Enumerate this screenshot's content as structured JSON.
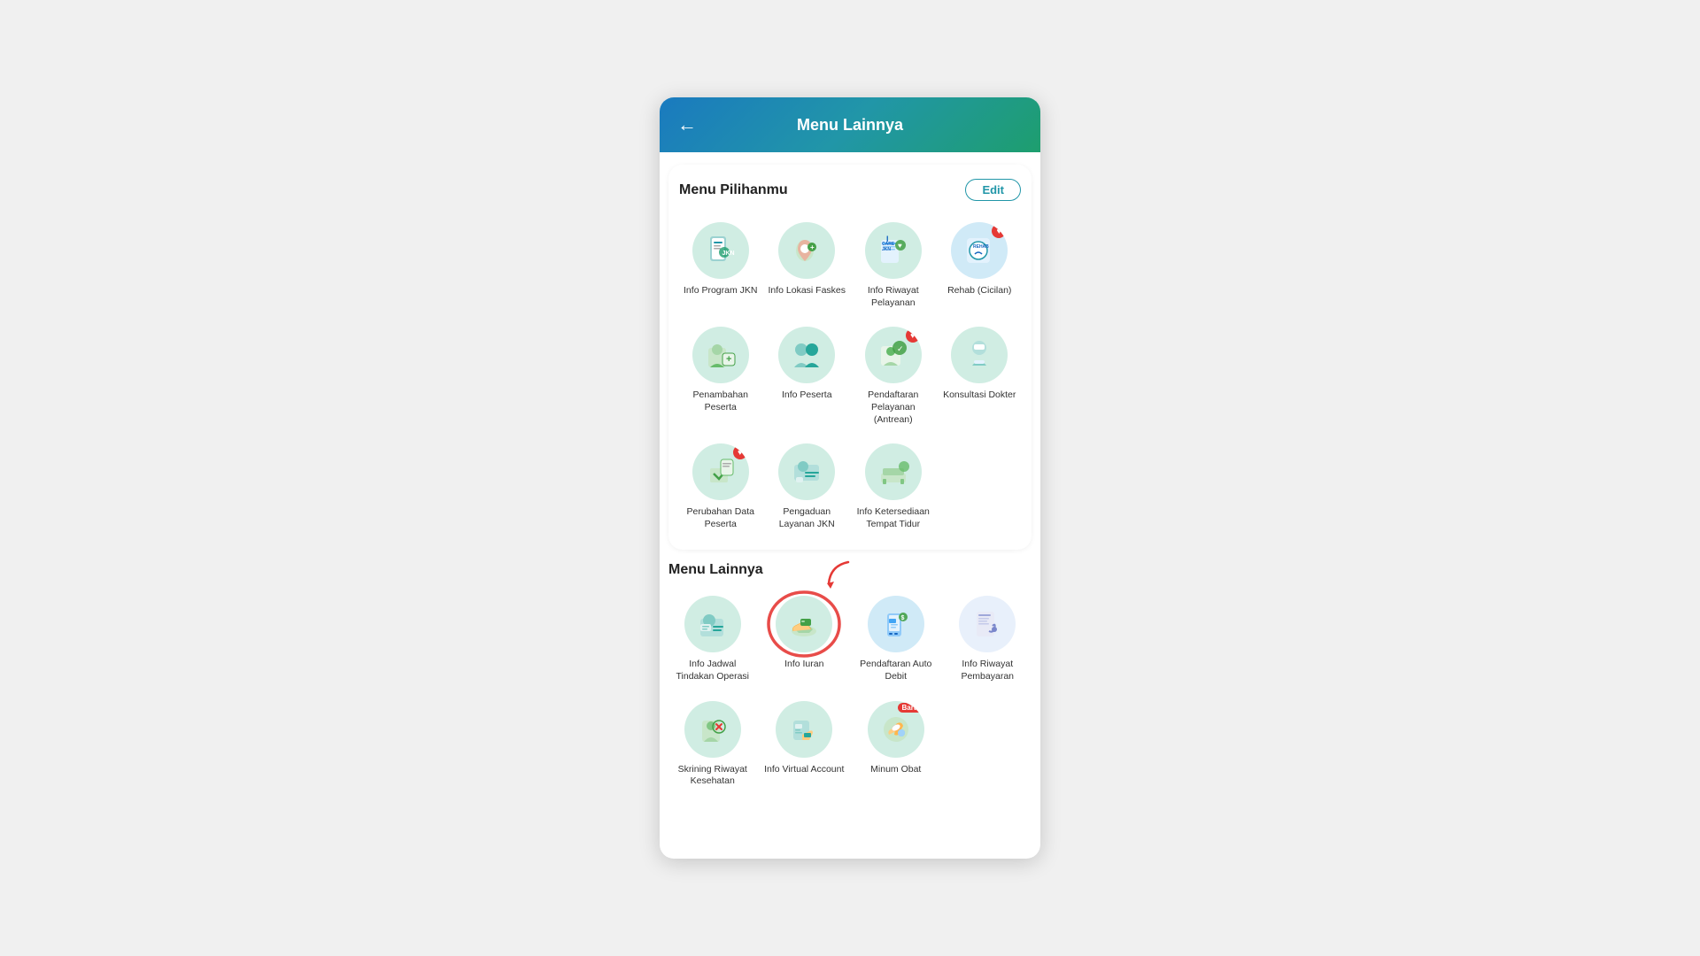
{
  "header": {
    "title": "Menu Lainnya",
    "back_label": "←"
  },
  "menu_pilihanmu": {
    "section_title": "Menu Pilihanmu",
    "edit_label": "Edit",
    "items": [
      {
        "id": "info-program-jkn",
        "label": "Info Program JKN",
        "badge": null,
        "color": "#d0ede3"
      },
      {
        "id": "info-lokasi-faskes",
        "label": "Info Lokasi Faskes",
        "badge": null,
        "color": "#d0ede3"
      },
      {
        "id": "info-riwayat-pelayanan",
        "label": "Info Riwayat Pelayanan",
        "badge": null,
        "color": "#d0ede3"
      },
      {
        "id": "rehab-cicilan",
        "label": "Rehab (Cicilan)",
        "badge": "heart",
        "color": "#d0eaf7"
      },
      {
        "id": "penambahan-peserta",
        "label": "Penambahan Peserta",
        "badge": null,
        "color": "#d0ede3"
      },
      {
        "id": "info-peserta",
        "label": "Info Peserta",
        "badge": null,
        "color": "#d0ede3"
      },
      {
        "id": "pendaftaran-pelayanan-antrean",
        "label": "Pendaftaran Pelayanan (Antrean)",
        "badge": "heart",
        "color": "#d0ede3"
      },
      {
        "id": "konsultasi-dokter",
        "label": "Konsultasi Dokter",
        "badge": null,
        "color": "#d0ede3"
      },
      {
        "id": "perubahan-data-peserta",
        "label": "Perubahan Data Peserta",
        "badge": "heart",
        "color": "#d0ede3"
      },
      {
        "id": "pengaduan-layanan-jkn",
        "label": "Pengaduan Layanan JKN",
        "badge": null,
        "color": "#d0ede3"
      },
      {
        "id": "info-ketersediaan-tempat-tidur",
        "label": "Info Ketersediaan Tempat Tidur",
        "badge": null,
        "color": "#d0ede3"
      }
    ]
  },
  "menu_lainnya": {
    "section_title": "Menu Lainnya",
    "items": [
      {
        "id": "info-jadwal-tindakan-operasi",
        "label": "Info Jadwal Tindakan Operasi",
        "badge": null,
        "color": "#d0ede3",
        "highlighted": false
      },
      {
        "id": "info-iuran",
        "label": "Info Iuran",
        "badge": null,
        "color": "#d0ede3",
        "highlighted": true
      },
      {
        "id": "pendaftaran-auto-debit",
        "label": "Pendaftaran Auto Debit",
        "badge": null,
        "color": "#d0eaf7",
        "highlighted": false
      },
      {
        "id": "info-riwayat-pembayaran",
        "label": "Info Riwayat Pembayaran",
        "badge": null,
        "color": "#e8f0fb",
        "highlighted": false
      },
      {
        "id": "skrining-riwayat-kesehatan",
        "label": "Skrining Riwayat Kesehatan",
        "badge": null,
        "color": "#d0ede3",
        "highlighted": false
      },
      {
        "id": "info-virtual-account",
        "label": "Info Virtual Account",
        "badge": null,
        "color": "#d0ede3",
        "highlighted": false
      },
      {
        "id": "minum-obat",
        "label": "Minum Obat",
        "badge": "new",
        "color": "#d0ede3",
        "highlighted": false
      }
    ]
  }
}
